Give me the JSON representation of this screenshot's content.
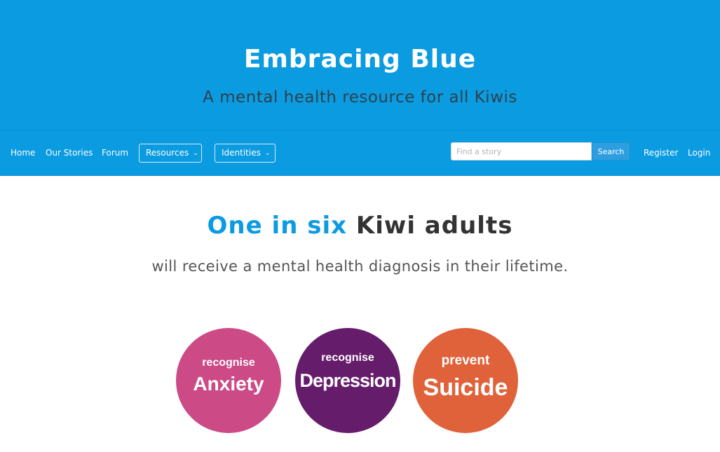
{
  "site": {
    "title": "Embracing Blue",
    "subtitle": "A mental health resource for all Kiwis"
  },
  "nav": {
    "home": "Home",
    "our_stories": "Our Stories",
    "forum": "Forum",
    "resources": "Resources",
    "identities": "Identities",
    "register": "Register",
    "login": "Login"
  },
  "search": {
    "placeholder": "Find a story",
    "value": "",
    "button": "Search"
  },
  "headline": {
    "accent": "One in six",
    "rest": "Kiwi adults",
    "sub": "will receive a mental health diagnosis in their lifetime."
  },
  "circles": [
    {
      "small": "recognise",
      "big": "Anxiety",
      "color": "#cc4a86"
    },
    {
      "small": "recognise",
      "big": "Depression",
      "color": "#651d6b"
    },
    {
      "small": "prevent",
      "big": "Suicide",
      "color": "#e0623a"
    }
  ],
  "colors": {
    "brand_blue": "#0b9be1",
    "text_dark": "#333333"
  }
}
